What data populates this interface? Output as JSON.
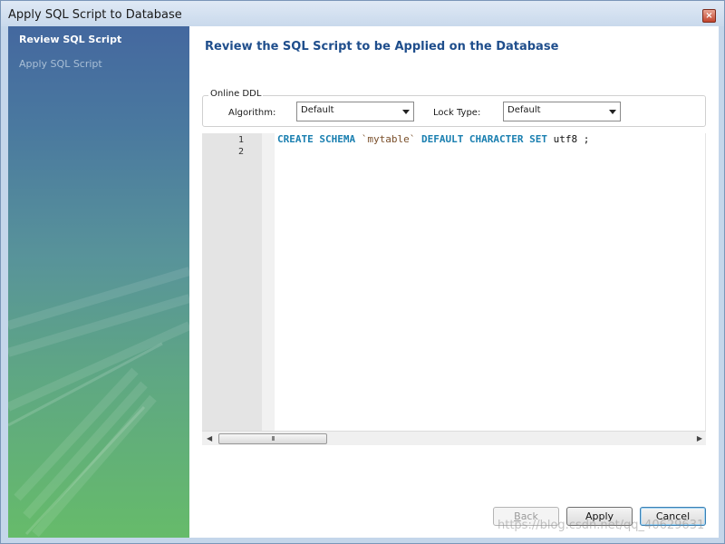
{
  "window": {
    "title": "Apply SQL Script to Database",
    "close_glyph": "×"
  },
  "sidebar": {
    "items": [
      {
        "label": "Review SQL Script",
        "active": true
      },
      {
        "label": "Apply SQL Script",
        "active": false
      }
    ]
  },
  "main": {
    "heading": "Review the SQL Script to be Applied on the Database",
    "online_ddl": {
      "legend": "Online DDL",
      "algorithm_label": "Algorithm:",
      "algorithm_value": "Default",
      "lock_type_label": "Lock Type:",
      "lock_type_value": "Default"
    },
    "editor": {
      "line_numbers": [
        "1",
        "2"
      ],
      "line1_tokens": {
        "kw1": "CREATE SCHEMA",
        "ident": "`mytable`",
        "kw2": "DEFAULT CHARACTER SET",
        "tail": "utf8 ;"
      },
      "scroll_thumb_grip": "III"
    }
  },
  "buttons": {
    "back": "Back",
    "apply": "Apply",
    "cancel": "Cancel"
  },
  "watermark": "https://blog.csdn.net/qq_40629631",
  "colors": {
    "keyword": "#1a7fb0",
    "heading": "#1f4e8c",
    "identifier": "#7a4f2a"
  }
}
